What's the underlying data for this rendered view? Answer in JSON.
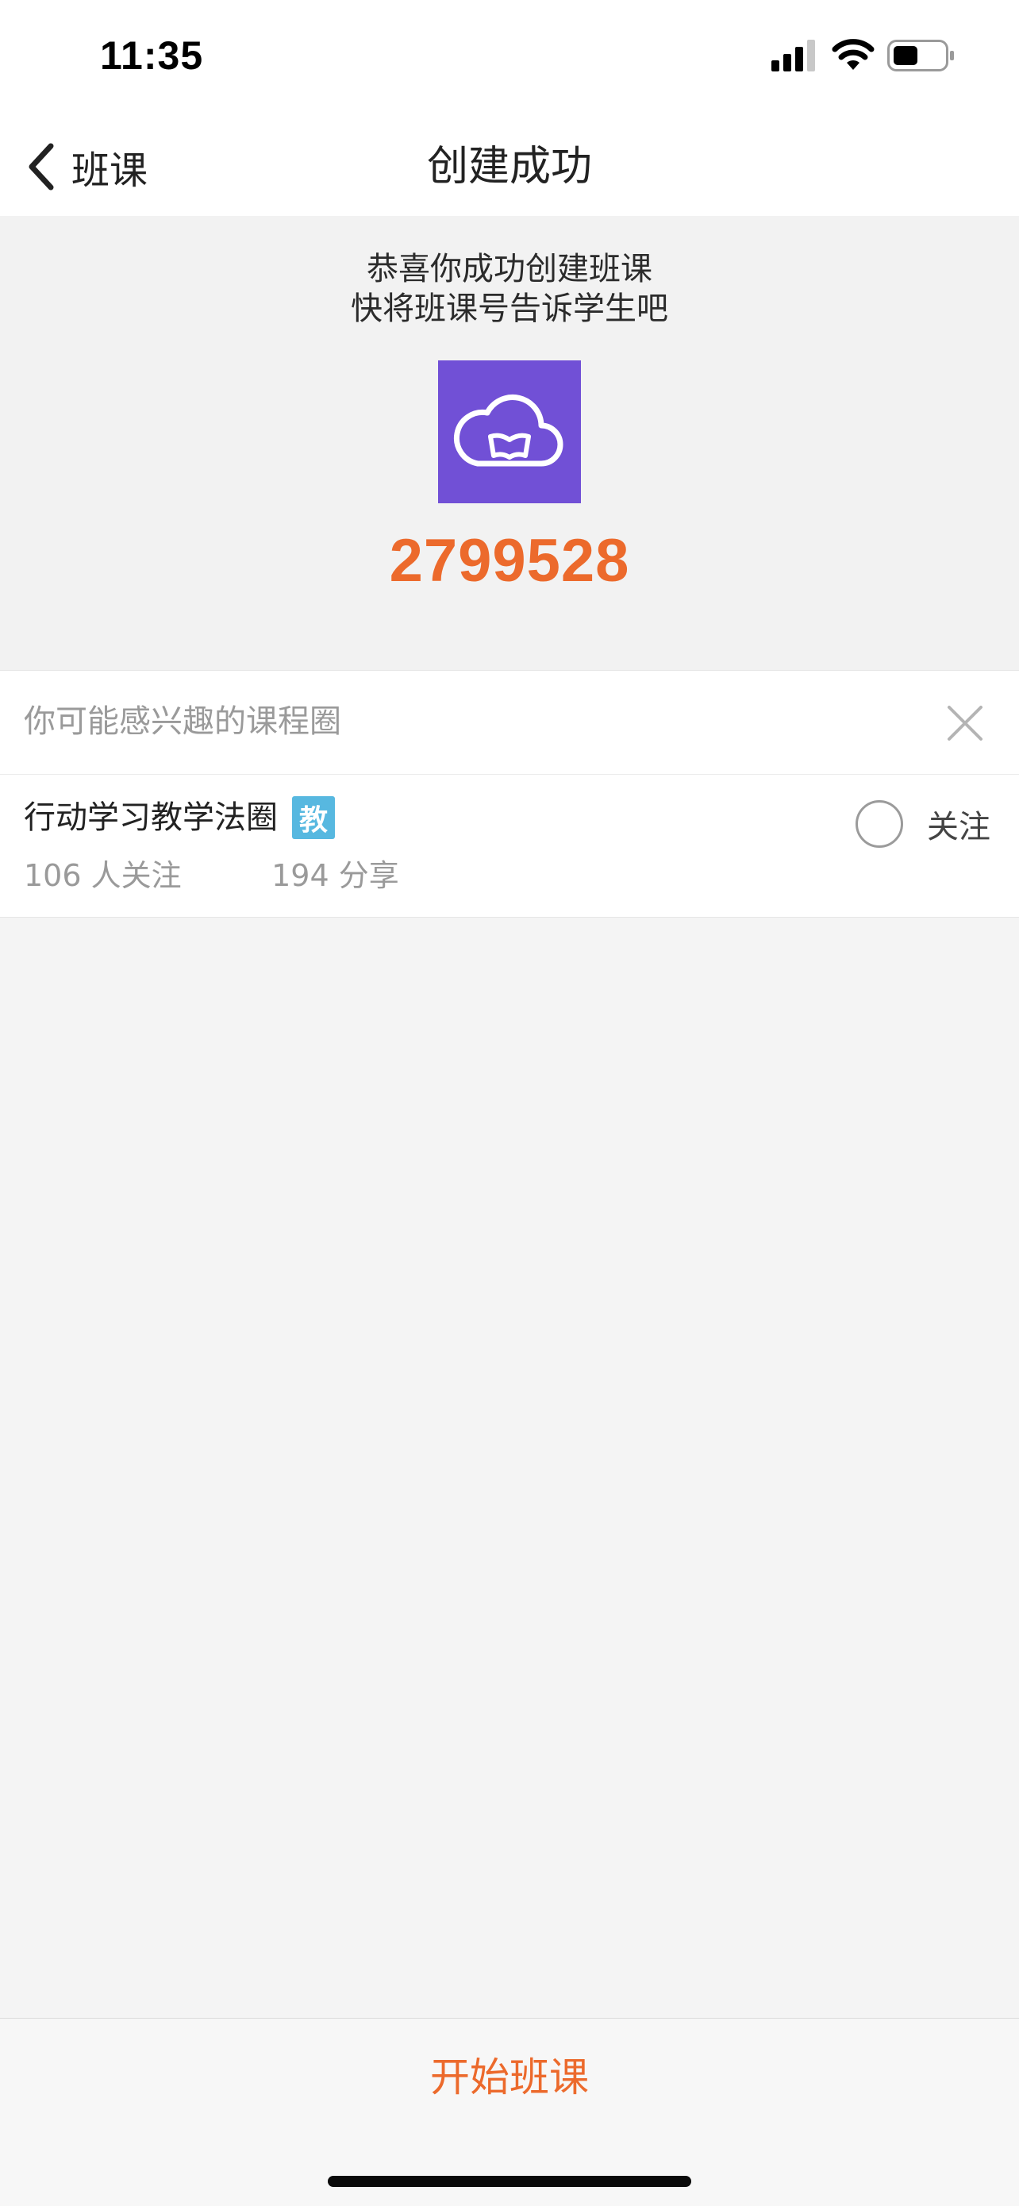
{
  "status_bar": {
    "time": "11:35"
  },
  "nav": {
    "back_label": "班课",
    "title": "创建成功"
  },
  "hero": {
    "message_line1": "恭喜你成功创建班课",
    "message_line2": "快将班课号告诉学生吧",
    "class_code": "2799528",
    "logo_icon": "cloud-book-icon"
  },
  "suggestions": {
    "title": "你可能感兴趣的课程圈",
    "items": [
      {
        "name": "行动学习教学法圈",
        "badge": "教",
        "followers": "106 人关注",
        "shares": "194 分享",
        "follow_label": "关注",
        "followed": false
      }
    ]
  },
  "bottom": {
    "start_label": "开始班课"
  },
  "colors": {
    "accent": "#ec6a2c",
    "logo_bg": "#7150d6",
    "badge_bg": "#57b8e0",
    "page_bg": "#f4f4f4"
  }
}
